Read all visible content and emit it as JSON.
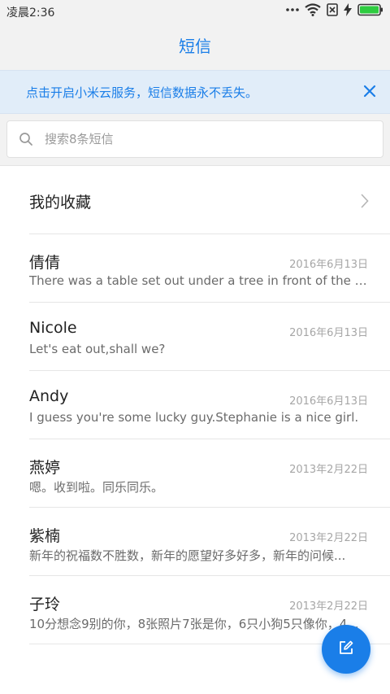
{
  "status_bar": {
    "time": "凌晨2:36",
    "icons": [
      "more-dots-icon",
      "wifi-icon",
      "no-sim-icon",
      "charging-bolt-icon",
      "battery-icon"
    ],
    "battery_color": "#2ecc40"
  },
  "header": {
    "title": "短信"
  },
  "banner": {
    "text": "点击开启小米云服务，短信数据永不丢失。",
    "close_icon": "close-icon"
  },
  "search": {
    "placeholder": "搜索8条短信",
    "value": ""
  },
  "favorites": {
    "label": "我的收藏"
  },
  "conversations": [
    {
      "name": "倩倩",
      "date": "2016年6月13日",
      "preview": "There was a table set out under a tree in front of the ho..."
    },
    {
      "name": "Nicole",
      "date": "2016年6月13日",
      "preview": "Let's eat out,shall we?"
    },
    {
      "name": "Andy",
      "date": "2016年6月13日",
      "preview": "I guess you're some lucky guy.Stephanie is a nice girl."
    },
    {
      "name": "燕婷",
      "date": "2013年2月22日",
      "preview": "嗯。收到啦。同乐同乐。"
    },
    {
      "name": "紫楠",
      "date": "2013年2月22日",
      "preview": "新年的祝福数不胜数，新年的愿望好多好多，新年的问候..."
    },
    {
      "name": "子玲",
      "date": "2013年2月22日",
      "preview": "10分想念9别的你，8张照片7张是你，6只小狗5只像你，4..."
    }
  ],
  "fab": {
    "icon": "compose-icon"
  },
  "colors": {
    "accent": "#1a7ee8",
    "banner_bg": "#e1edf9",
    "header_bg": "#f2f2f2"
  }
}
